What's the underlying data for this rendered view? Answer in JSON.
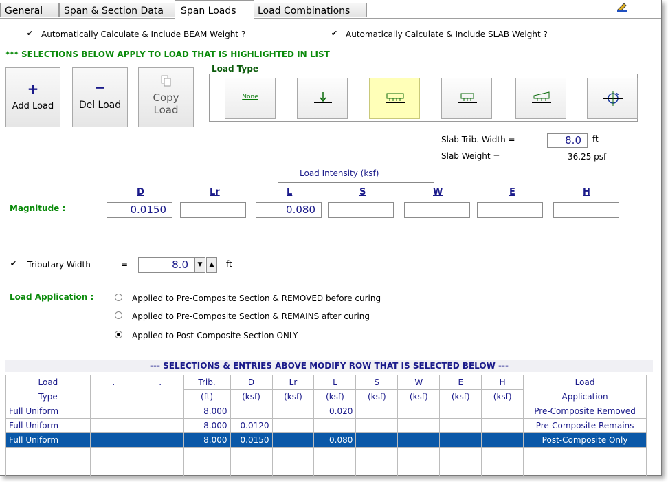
{
  "tabs": [
    "General",
    "Span & Section Data",
    "Span Loads",
    "Load Combinations"
  ],
  "active_tab": "Span Loads",
  "beam_weight_label": "Automatically Calculate & Include BEAM Weight ?",
  "slab_weight_label": "Automatically Calculate & Include SLAB Weight ?",
  "selection_note": "*** SELECTIONS BELOW APPLY TO LOAD THAT IS HIGHLIGHTED IN LIST",
  "buttons": {
    "add": {
      "glyph": "+",
      "label": "Add Load"
    },
    "del": {
      "glyph": "−",
      "label": "Del Load"
    },
    "copy": {
      "line1": "Copy",
      "line2": "Load"
    }
  },
  "load_type_label": "Load Type",
  "load_types": [
    "None",
    "Point",
    "Full Uniform",
    "Partial Uniform",
    "Trapezoidal",
    "Moment"
  ],
  "selected_load_type": "Full Uniform",
  "none_label": "None",
  "slab": {
    "trib_label": "Slab Trib. Width =",
    "trib_value": "8.0",
    "trib_unit": "ft",
    "weight_label": "Slab Weight =",
    "weight_value": "36.25 psf"
  },
  "intensity_label": "Load Intensity    (ksf)",
  "magnitude_label": "Magnitude :",
  "magnitude_cols": [
    "D",
    "Lr",
    "L",
    "S",
    "W",
    "E",
    "H"
  ],
  "magnitude_values": [
    "0.0150",
    "",
    "0.080",
    "",
    "",
    "",
    ""
  ],
  "tributary": {
    "label": "Tributary Width",
    "eq": "=",
    "value": "8.0",
    "unit": "ft"
  },
  "load_application": {
    "label": "Load Application :",
    "options": [
      "Applied to Pre-Composite Section & REMOVED before curing",
      "Applied to Pre-Composite Section & REMAINS after curing",
      "Applied to Post-Composite Section ONLY"
    ],
    "selected": 2
  },
  "table_note": "--- SELECTIONS & ENTRIES ABOVE MODIFY ROW THAT IS SELECTED BELOW ---",
  "table": {
    "header1": [
      "Load",
      ".",
      ".",
      "Trib.",
      "D",
      "Lr",
      "L",
      "S",
      "W",
      "E",
      "H",
      "Load"
    ],
    "header2": [
      "Type",
      "",
      "",
      "(ft)",
      "(ksf)",
      "(ksf)",
      "(ksf)",
      "(ksf)",
      "(ksf)",
      "(ksf)",
      "(ksf)",
      "Application"
    ],
    "rows": [
      [
        "Full Uniform",
        "",
        "",
        "8.000",
        "",
        "",
        "0.020",
        "",
        "",
        "",
        "",
        "Pre-Composite Removed"
      ],
      [
        "Full Uniform",
        "",
        "",
        "8.000",
        "0.0120",
        "",
        "",
        "",
        "",
        "",
        "",
        "Pre-Composite Remains"
      ],
      [
        "Full Uniform",
        "",
        "",
        "8.000",
        "0.0150",
        "",
        "0.080",
        "",
        "",
        "",
        "",
        "Post-Composite Only"
      ]
    ],
    "selected_row": 2
  },
  "colors": {
    "accent_green": "#0a8a0a",
    "header_blue": "#1a1a8a",
    "selection": "#0a58a8",
    "highlight": "#ffffb8"
  }
}
